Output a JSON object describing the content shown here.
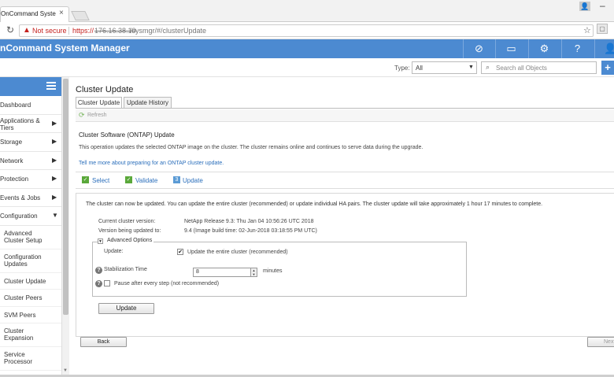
{
  "browser": {
    "tab_title": "OnCommand System Ma",
    "tab_close": "×",
    "security_label": "Not secure",
    "url_protocol": "https://",
    "url_host": "176.16.38.10",
    "url_path": "/sysmgr/#/clusterUpdate"
  },
  "header": {
    "app_title": "nCommand System Manager",
    "icons": [
      "compass-icon",
      "chat-icon",
      "gear-icon",
      "help-icon",
      "user-icon"
    ]
  },
  "filter": {
    "type_label": "Type:",
    "type_value": "All",
    "search_placeholder": "Search all Objects",
    "add_label": "+"
  },
  "sidebar": {
    "items": [
      {
        "label": "Dashboard",
        "chevron": ""
      },
      {
        "label": "Applications & Tiers",
        "chevron": "▶"
      },
      {
        "label": "Storage",
        "chevron": "▶"
      },
      {
        "label": "Network",
        "chevron": "▶"
      },
      {
        "label": "Protection",
        "chevron": "▶"
      },
      {
        "label": "Events & Jobs",
        "chevron": "▶"
      },
      {
        "label": "Configuration",
        "chevron": "▼"
      }
    ],
    "sub_items": [
      {
        "label": "Advanced Cluster Setup"
      },
      {
        "label": "Configuration Updates"
      },
      {
        "label": "Cluster Update"
      },
      {
        "label": "Cluster Peers"
      },
      {
        "label": "SVM Peers"
      },
      {
        "label": "Cluster Expansion"
      },
      {
        "label": "Service Processor"
      }
    ]
  },
  "main": {
    "page_title": "Cluster Update",
    "tabs": [
      {
        "label": "Cluster Update",
        "active": true
      },
      {
        "label": "Update History",
        "active": false
      }
    ],
    "toolbar": {
      "refresh_label": "Refresh"
    },
    "section_title": "Cluster Software (ONTAP) Update",
    "description": "This operation updates the selected ONTAP image on the cluster. The cluster remains online and continues to serve data during the upgrade.",
    "link_text": "Tell me more about preparing for an ONTAP cluster update.",
    "steps": [
      {
        "label": "Select",
        "icon": "✓",
        "color": "#5aa83a"
      },
      {
        "label": "Validate",
        "icon": "✓",
        "color": "#5aa83a"
      },
      {
        "label": "Update",
        "icon": "3",
        "color": "#5b9bd5"
      }
    ],
    "ready_message": "The cluster can now be updated. You can update the entire cluster (recommended) or update individual HA pairs. The cluster update will take approximately 1 hour 17 minutes to complete.",
    "current_version_label": "Current cluster version:",
    "current_version_value": "NetApp Release 9.3: Thu Jan 04 10:56:26 UTC 2018",
    "target_version_label": "Version being updated to:",
    "target_version_value": "9.4 (Image build time: 02-Jun-2018 03:18:55 PM UTC)",
    "advanced": {
      "legend": "Advanced Options",
      "update_label": "Update:",
      "update_option": "Update the entire cluster (recommended)",
      "update_checked": true,
      "stabilization_label": "Stabilization Time",
      "stabilization_value": "8",
      "stabilization_unit": "minutes",
      "pause_label": "Pause after every step (not recommended)",
      "pause_checked": false
    },
    "update_button": "Update",
    "back_button": "Back",
    "next_button": "Next"
  }
}
